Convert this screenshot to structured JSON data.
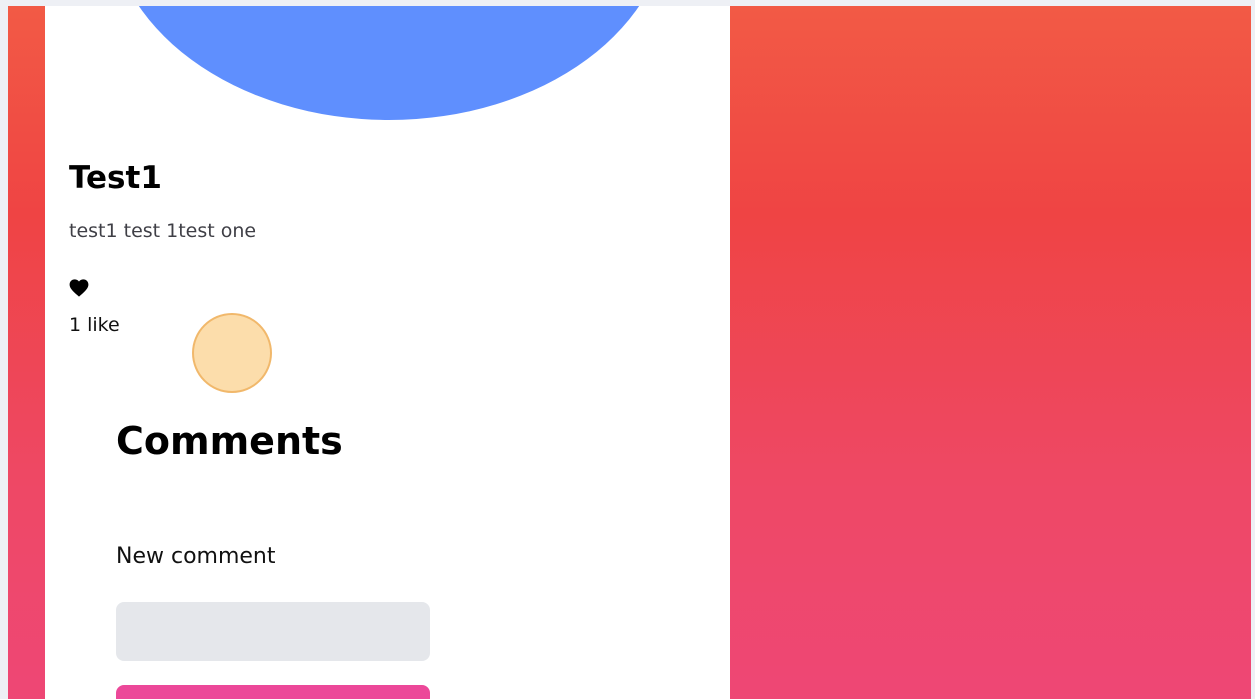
{
  "post": {
    "title": "Test1",
    "description": "test1 test 1test one",
    "like_icon": "heart-icon",
    "likes_label": "1 like"
  },
  "comments": {
    "heading": "Comments",
    "new_comment_label": "New comment",
    "input_value": "",
    "input_placeholder": ""
  },
  "colors": {
    "cover_circle": "#5f8ffe",
    "background_gradient_top": "#f25a45",
    "background_gradient_bottom": "#ee4775",
    "card": "#ffffff",
    "input_background": "#e5e7eb",
    "submit_button": "#ec4899",
    "click_marker": "#fbd496"
  }
}
